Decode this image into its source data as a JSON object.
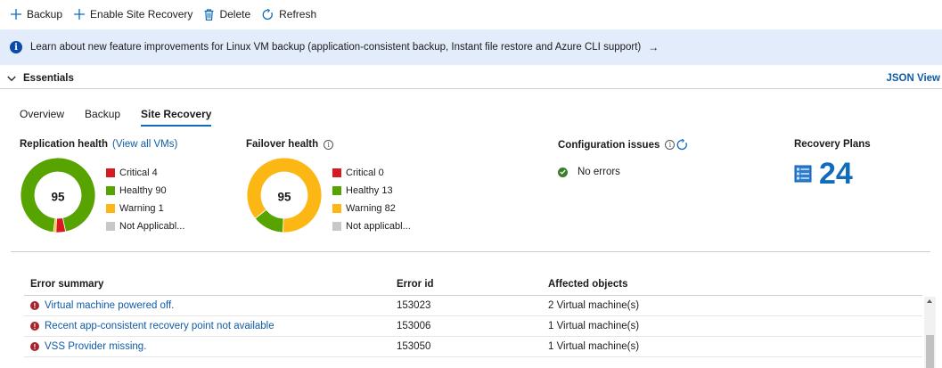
{
  "toolbar": {
    "backup": "Backup",
    "enable_site_recovery": "Enable Site Recovery",
    "delete": "Delete",
    "refresh": "Refresh"
  },
  "banner": {
    "text": "Learn about new feature improvements for Linux VM backup (application-consistent backup, Instant file restore and Azure CLI support)",
    "arrow": "→"
  },
  "essentials": {
    "title": "Essentials",
    "json_view": "JSON View"
  },
  "tabs": [
    "Overview",
    "Backup",
    "Site Recovery"
  ],
  "active_tab": "Site Recovery",
  "replication_health": {
    "title": "Replication health",
    "link": "(View all VMs)",
    "total": "95",
    "legend": [
      {
        "label": "Critical 4",
        "value": 4,
        "color": "#d71920"
      },
      {
        "label": "Healthy 90",
        "value": 90,
        "color": "#57a300"
      },
      {
        "label": "Warning 1",
        "value": 1,
        "color": "#fcb714"
      },
      {
        "label": "Not Applicabl...",
        "value": 0,
        "color": "#c8c8c8"
      }
    ]
  },
  "failover_health": {
    "title": "Failover health",
    "total": "95",
    "legend": [
      {
        "label": "Critical 0",
        "value": 0,
        "color": "#d71920"
      },
      {
        "label": "Healthy 13",
        "value": 13,
        "color": "#57a300"
      },
      {
        "label": "Warning 82",
        "value": 82,
        "color": "#fcb714"
      },
      {
        "label": "Not applicabl...",
        "value": 0,
        "color": "#c8c8c8"
      }
    ]
  },
  "configuration_issues": {
    "title": "Configuration issues",
    "status": "No errors"
  },
  "recovery_plans": {
    "title": "Recovery Plans",
    "count": "24"
  },
  "error_table": {
    "headers": [
      "Error summary",
      "Error id",
      "Affected objects"
    ],
    "rows": [
      {
        "summary": "Virtual machine powered off.",
        "id": "153023",
        "affected": "2 Virtual machine(s)"
      },
      {
        "summary": "Recent app-consistent recovery point not available",
        "id": "153006",
        "affected": "1 Virtual machine(s)"
      },
      {
        "summary": "VSS Provider missing.",
        "id": "153050",
        "affected": "1 Virtual machine(s)"
      }
    ]
  },
  "colors": {
    "accent": "#0f6cbd",
    "link": "#0f5ca8",
    "banner_bg": "#e3ecfb",
    "critical": "#d71920",
    "healthy": "#57a300",
    "warning": "#fcb714",
    "not_applicable": "#c8c8c8"
  }
}
